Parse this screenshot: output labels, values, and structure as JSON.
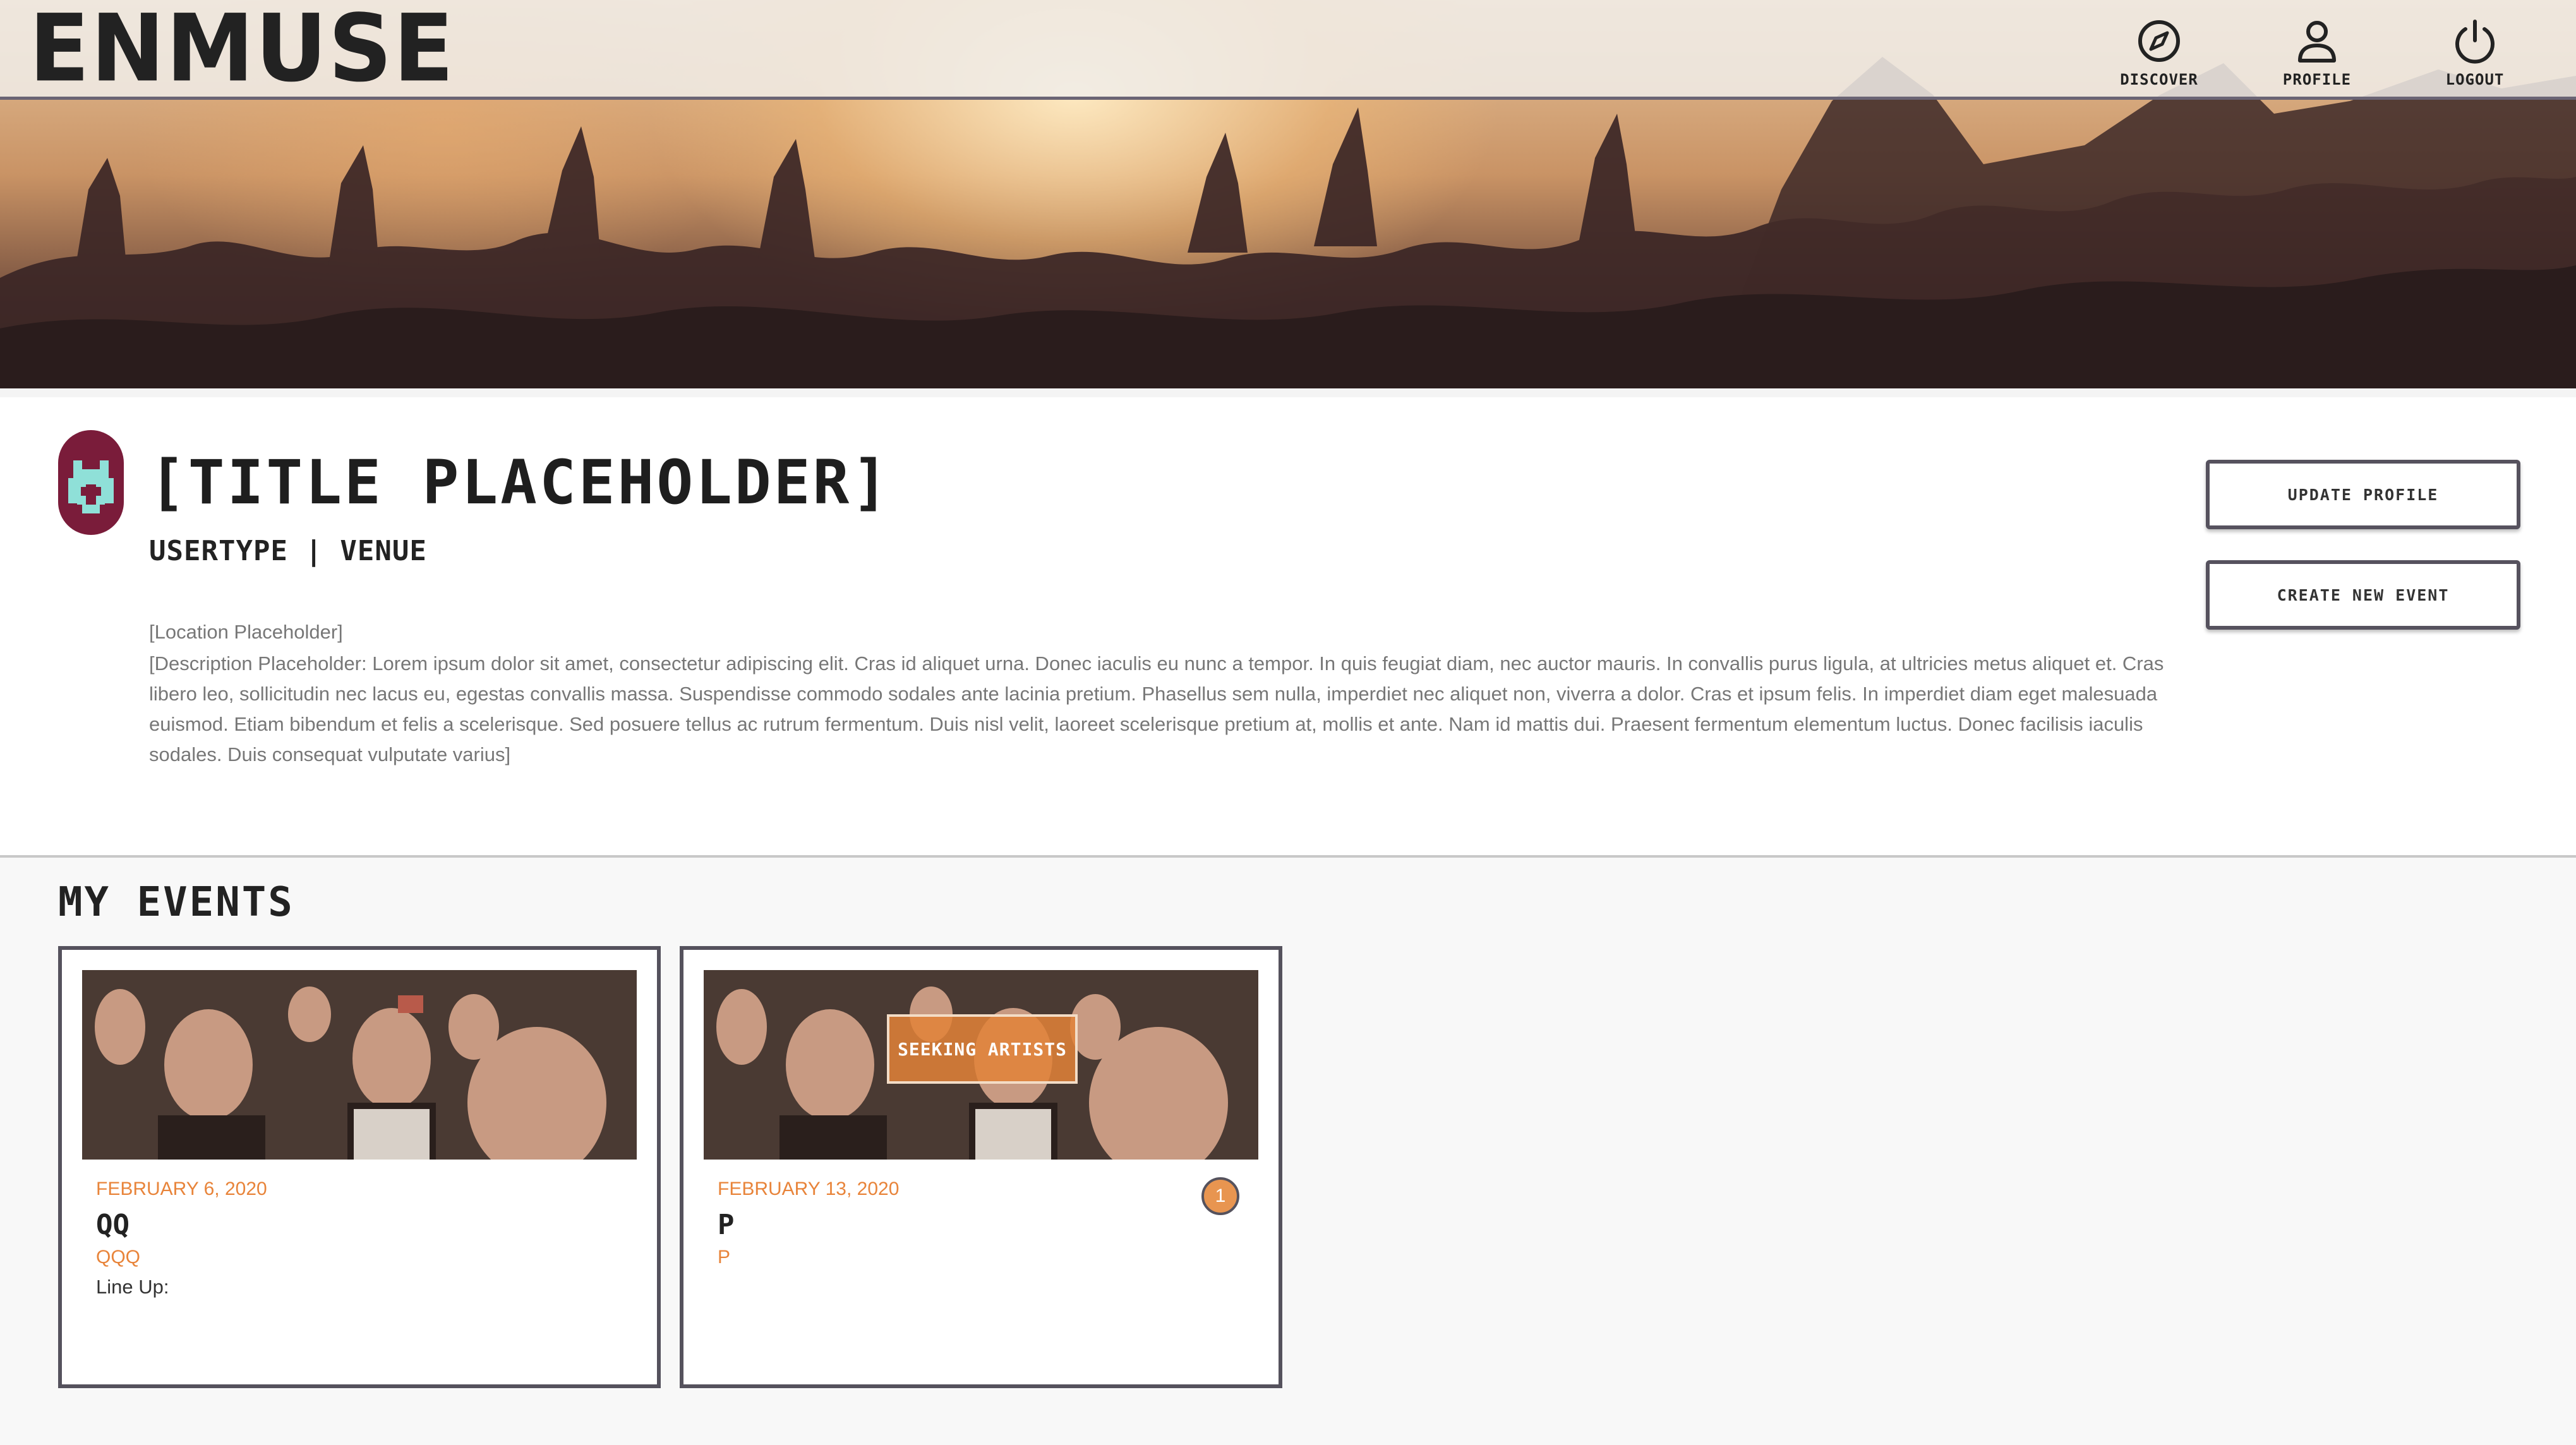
{
  "brand": {
    "name": "ENMUSE",
    "accent": "#e8843a"
  },
  "nav": {
    "items": [
      {
        "label": "DISCOVER",
        "icon": "compass-icon"
      },
      {
        "label": "PROFILE",
        "icon": "user-icon"
      },
      {
        "label": "LOGOUT",
        "icon": "power-icon"
      }
    ]
  },
  "profile": {
    "title": "[TITLE PLACEHOLDER]",
    "usertype": "USERTYPE | VENUE",
    "location": "[Location Placeholder]",
    "description": "[Description Placeholder: Lorem ipsum dolor sit amet, consectetur adipiscing elit. Cras id aliquet urna. Donec iaculis eu nunc a tempor. In quis feugiat diam, nec auctor mauris. In convallis purus ligula, at ultricies metus aliquet et. Cras libero leo, sollicitudin nec lacus eu, egestas convallis massa. Suspendisse commodo sodales ante lacinia pretium. Phasellus sem nulla, imperdiet nec aliquet non, viverra a dolor. Cras et ipsum felis. In imperdiet diam eget malesuada euismod. Etiam bibendum et felis a scelerisque. Sed posuere tellus ac rutrum fermentum. Duis nisl velit, laoreet scelerisque pretium at, mollis et ante. Nam id mattis dui. Praesent fermentum elementum luctus. Donec facilisis iaculis sodales. Duis consequat vulputate varius]",
    "update_button": "UPDATE PROFILE",
    "create_button": "CREATE NEW EVENT"
  },
  "events": {
    "section_title": "MY EVENTS",
    "cards": [
      {
        "date": "FEBRUARY 6, 2020",
        "name": "QQ",
        "subtitle": "QQQ",
        "lineup": "Line Up:"
      },
      {
        "date": "FEBRUARY 13, 2020",
        "name": "P",
        "subtitle": "P",
        "badge": "SEEKING ARTISTS",
        "count": "1"
      }
    ]
  }
}
